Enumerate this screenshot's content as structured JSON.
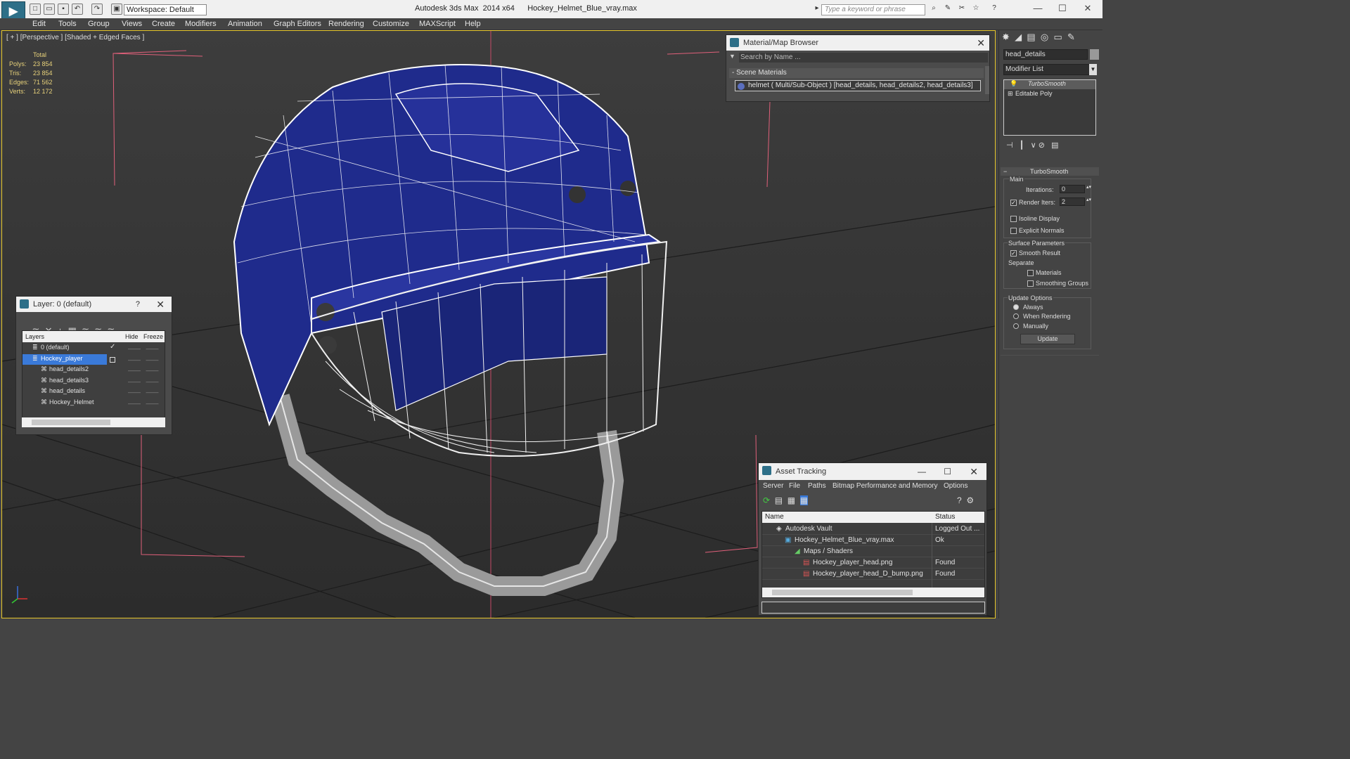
{
  "titlebar": {
    "title": "Autodesk 3ds Max  2014 x64      Hockey_Helmet_Blue_vray.max",
    "workspace": "Workspace: Default",
    "search_placeholder": "Type a keyword or phrase"
  },
  "menu": [
    "Edit",
    "Tools",
    "Group",
    "Views",
    "Create",
    "Modifiers",
    "Animation",
    "Graph Editors",
    "Rendering",
    "Customize",
    "MAXScript",
    "Help"
  ],
  "viewport": {
    "label": "[ + ] [Perspective ] [Shaded + Edged Faces ]",
    "stats": {
      "header": "Total",
      "rows": [
        {
          "label": "Polys:",
          "value": "23 854"
        },
        {
          "label": "Tris:",
          "value": "23 854"
        },
        {
          "label": "Edges:",
          "value": "71 562"
        },
        {
          "label": "Verts:",
          "value": "12 172"
        }
      ]
    }
  },
  "material_browser": {
    "title": "Material/Map Browser",
    "search_placeholder": "Search by Name ...",
    "section": "- Scene Materials",
    "item": "helmet  ( Multi/Sub-Object )  [head_details, head_details2, head_details3]"
  },
  "layer_panel": {
    "title": "Layer: 0 (default)",
    "help": "?",
    "columns": {
      "layers": "Layers",
      "hide": "Hide",
      "freeze": "Freeze"
    },
    "rows": [
      {
        "name": "0 (default)"
      },
      {
        "name": "Hockey_player"
      },
      {
        "name": "head_details2"
      },
      {
        "name": "head_details3"
      },
      {
        "name": "head_details"
      },
      {
        "name": "Hockey_Helmet"
      }
    ]
  },
  "command_panel": {
    "object_name": "head_details",
    "modifier_list": "Modifier List",
    "stack": [
      "TurboSmooth",
      "Editable Poly"
    ],
    "rollout_title": "TurboSmooth",
    "main_label": "Main",
    "iterations_label": "Iterations:",
    "iterations_value": "0",
    "render_iters_label": "Render Iters:",
    "render_iters_value": "2",
    "isoline": "Isoline Display",
    "explicit_normals": "Explicit Normals",
    "surface_params": "Surface Parameters",
    "smooth_result": "Smooth Result",
    "separate": "Separate",
    "materials": "Materials",
    "smoothing_groups": "Smoothing Groups",
    "update_options": "Update Options",
    "always": "Always",
    "when_rendering": "When Rendering",
    "manually": "Manually",
    "update_btn": "Update"
  },
  "asset_tracking": {
    "title": "Asset Tracking",
    "menu": [
      "Server",
      "File",
      "Paths",
      "Bitmap Performance and Memory",
      "Options"
    ],
    "columns": {
      "name": "Name",
      "status": "Status"
    },
    "rows": [
      {
        "name": "Autodesk Vault",
        "status": "Logged Out ..."
      },
      {
        "name": "Hockey_Helmet_Blue_vray.max",
        "status": "Ok"
      },
      {
        "name": "Maps / Shaders",
        "status": ""
      },
      {
        "name": "Hockey_player_head.png",
        "status": "Found"
      },
      {
        "name": "Hockey_player_head_D_bump.png",
        "status": "Found"
      }
    ]
  },
  "colors": {
    "helmet_blue": "#1e2a8a",
    "viewport_border": "#e7c72b",
    "selection": "#3a7ad9"
  }
}
